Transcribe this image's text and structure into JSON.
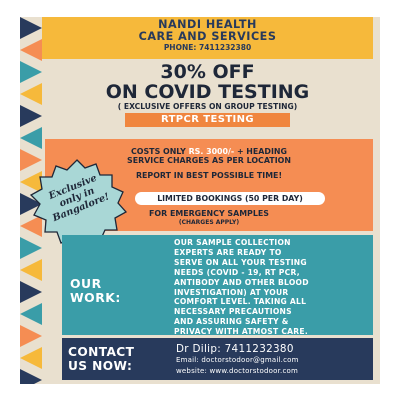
{
  "colors": {
    "background": "#e9e0cf",
    "yellow": "#f6b93b",
    "orange": "#f58d53",
    "teal": "#3a9da8",
    "navy": "#283a5c",
    "badge": "#a9d7d6"
  },
  "header": {
    "title_line1": "NANDI HEALTH",
    "title_line2": "CARE AND SERVICES",
    "phone": "PHONE: 7411232380"
  },
  "offer": {
    "line1": "30% OFF",
    "line2": "ON COVID TESTING",
    "sub": "( EXCLUSIVE OFFERS ON GROUP TESTING)",
    "test_label": "RTPCR TESTING"
  },
  "pricing": {
    "cost_prefix": "COSTS ONLY ",
    "cost_amount": "RS. 3000/-",
    "cost_suffix": " + HEADING",
    "line2": "SERVICE CHARGES AS PER LOCATION",
    "report": "REPORT IN BEST POSSIBLE TIME!",
    "limited": "LIMITED BOOKINGS (50 PER DAY)",
    "emergency": "FOR EMERGENCY SAMPLES",
    "charges": "(CHARGES APPLY)"
  },
  "badge": {
    "line1": "Exclusive",
    "line2": "only in",
    "line3": "Bangalore!"
  },
  "work": {
    "label_line1": "OUR",
    "label_line2": "WORK:",
    "lines": [
      "OUR SAMPLE COLLECTION",
      "EXPERTS ARE READY TO",
      "SERVE ON ALL YOUR TESTING",
      "NEEDS (COVID - 19, RT PCR,",
      "ANTIBODY AND OTHER BLOOD",
      "INVESTIGATION) AT YOUR",
      "COMFORT LEVEL. TAKING ALL",
      "NECESSARY PRECAUTIONS",
      "AND ASSURING SAFETY &",
      "PRIVACY WITH ATMOST CARE."
    ]
  },
  "contact": {
    "label_line1": "CONTACT",
    "label_line2": "US NOW:",
    "name": "Dr Dilip: 7411232380",
    "email": "Email: doctorstodoor@gmail.com",
    "website": "website: www.doctorstodoor.com"
  }
}
